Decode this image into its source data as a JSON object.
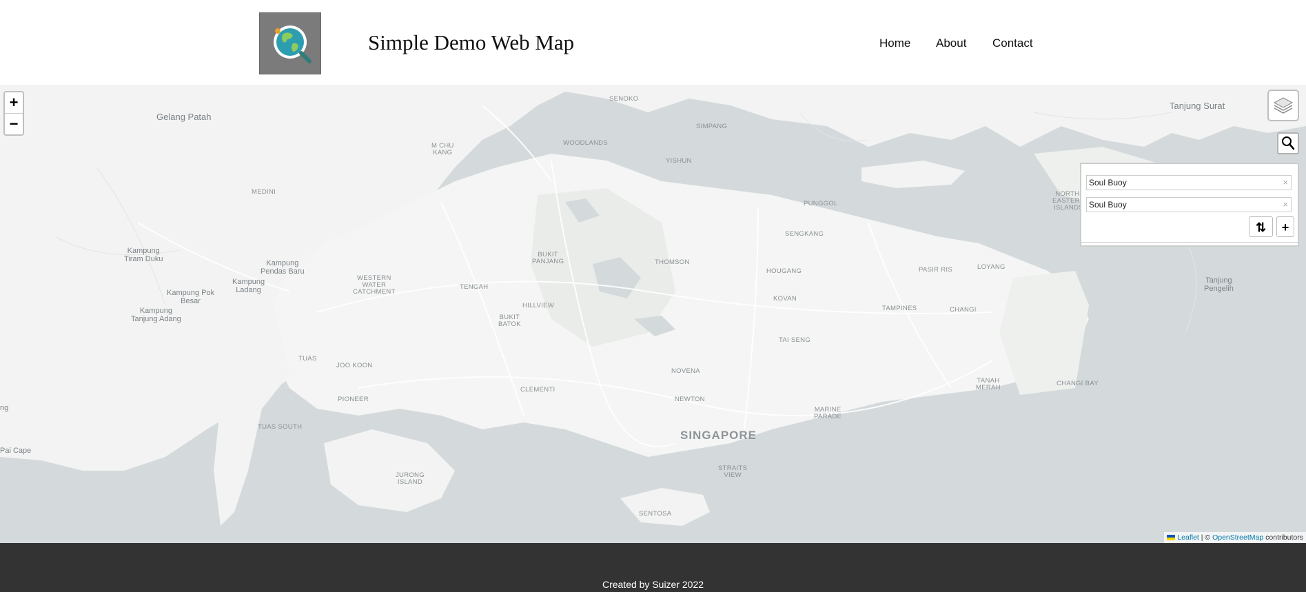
{
  "header": {
    "title": "Simple Demo Web Map",
    "nav": [
      "Home",
      "About",
      "Contact"
    ]
  },
  "map": {
    "zoom_in": "+",
    "zoom_out": "−",
    "places": {
      "gelang_patah": "Gelang Patah",
      "tanjung_surat": "Tanjung Surat",
      "senoko": "SENOKO",
      "woodlands": "WOODLANDS",
      "simpang": "SIMPANG",
      "yishun": "YISHUN",
      "m_chu_kang": "M CHU\nKANG",
      "medini": "MEDINI",
      "punggol": "PUNGGOL",
      "north_eastern": "NORTH-\nEASTERN\nISLANDS",
      "sengkang": "SENGKANG",
      "kampung_tiram_duku": "Kampung\nTiram Duku",
      "kampung_pendas_baru": "Kampung\nPendas Baru",
      "kampung_ladang": "Kampung\nLadang",
      "kampung_pok_besar": "Kampung Pok\nBesar",
      "kampung_tanjung_adang": "Kampung\nTanjung Adang",
      "bukit_panjang": "BUKIT\nPANJANG",
      "thomson": "THOMSON",
      "pasir_ris": "PASIR RIS",
      "loyang": "LOYANG",
      "western_water": "WESTERN\nWATER\nCATCHMENT",
      "tengah": "TENGAH",
      "hougang": "HOUGANG",
      "tanjung_pengelih": "Tanjung\nPengelih",
      "kovan": "KOVAN",
      "hillview": "HILLVIEW",
      "tampines": "TAMPINES",
      "changi": "CHANGI",
      "bukit_batok": "BUKIT\nBATOK",
      "tai_seng": "TAI SENG",
      "tuas": "TUAS",
      "joo_koon": "JOO KOON",
      "novena": "NOVENA",
      "tanah_merah": "TANAH\nMERAH",
      "changi_bay": "CHANGI BAY",
      "clementi": "CLEMENTI",
      "pioneer": "PIONEER",
      "newton": "NEWTON",
      "marine_parade": "MARINE\nPARADE",
      "tuas_south": "TUAS SOUTH",
      "singapore": "SINGAPORE",
      "pai_cape": "Pai Cape",
      "ng": "ng",
      "straits_view": "STRAITS\nVIEW",
      "jurong_island": "JURONG\nISLAND",
      "sentosa": "SENTOSA"
    },
    "routing": {
      "start": "Soul Buoy",
      "end": "Soul Buoy",
      "clear": "×",
      "reverse": "⇅",
      "add": "+"
    },
    "attribution": {
      "leaflet": "Leaflet",
      "sep": " | © ",
      "osm": "OpenStreetMap",
      "contributors": " contributors"
    }
  },
  "footer": {
    "text": "Created by Suizer 2022"
  },
  "colors": {
    "land": "#f2f3f2",
    "water": "#d4dadc",
    "park": "#e9ece9",
    "footer": "#333333"
  }
}
